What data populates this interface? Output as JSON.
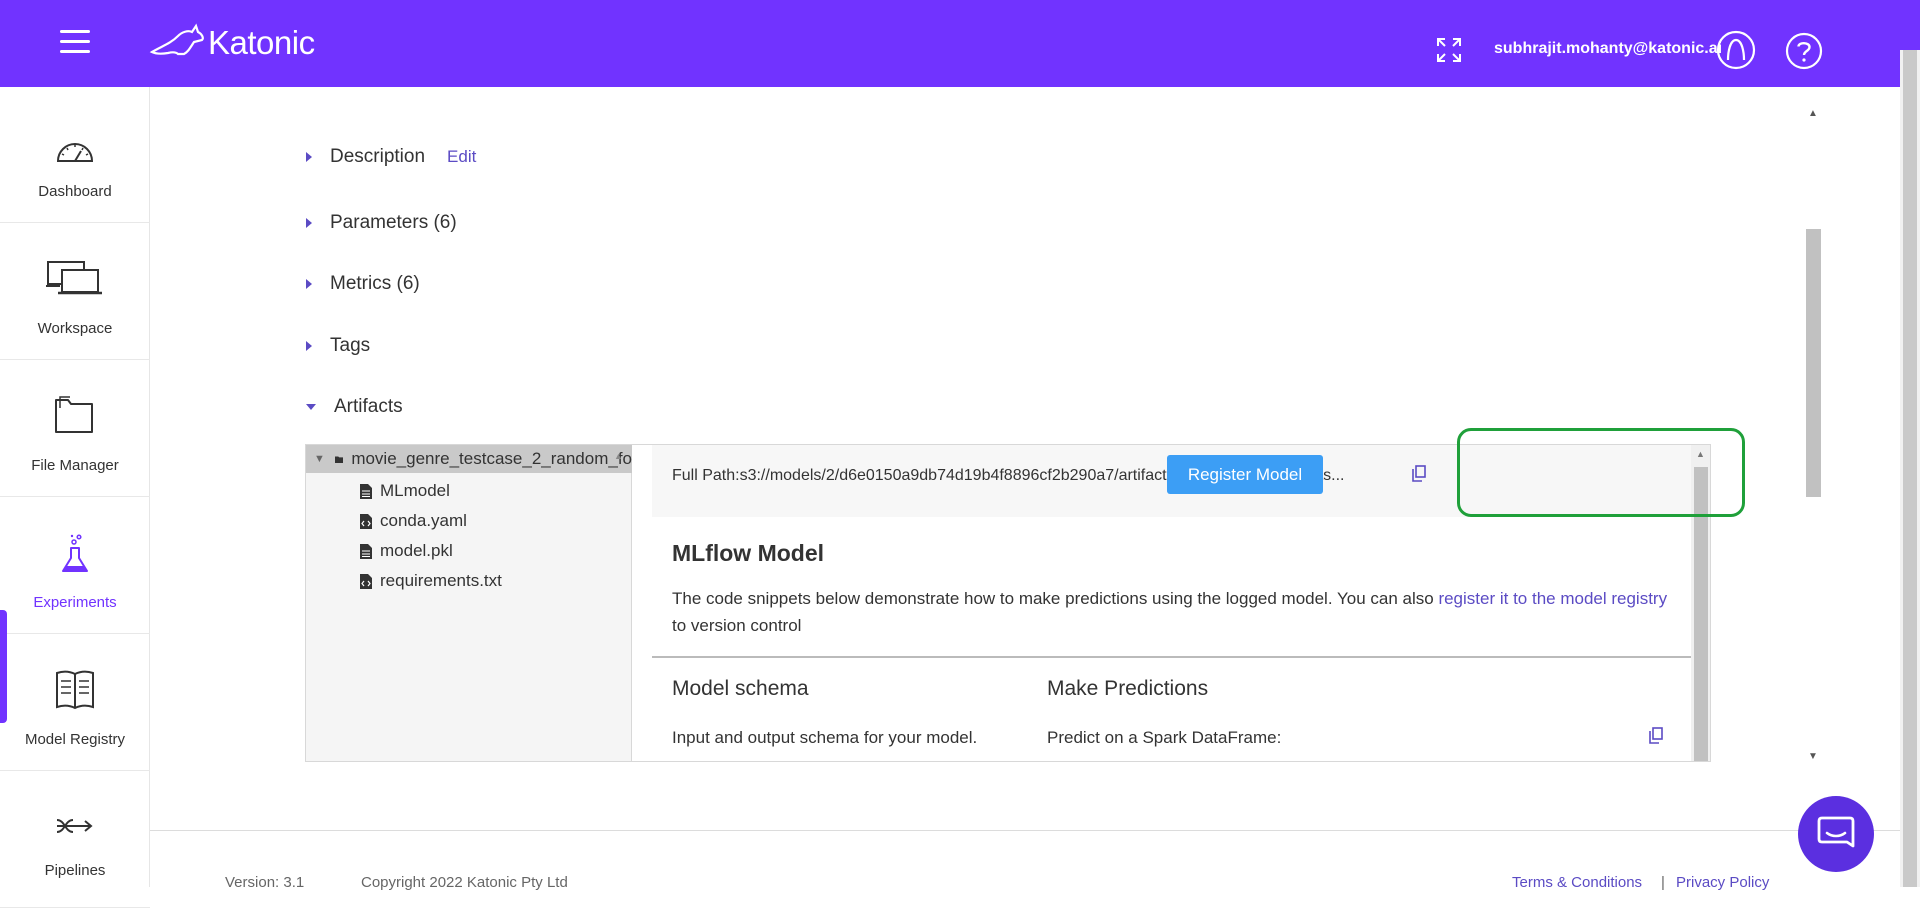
{
  "header": {
    "brand": "Katonic",
    "user_email": "subhrajit.mohanty@katonic.ai"
  },
  "sidebar": {
    "items": [
      {
        "label": "Dashboard",
        "icon": "gauge-icon"
      },
      {
        "label": "Workspace",
        "icon": "laptops-icon"
      },
      {
        "label": "File Manager",
        "icon": "folder-icon"
      },
      {
        "label": "Experiments",
        "icon": "flask-icon",
        "active": true
      },
      {
        "label": "Model Registry",
        "icon": "book-icon"
      },
      {
        "label": "Pipelines",
        "icon": "pipeline-icon"
      }
    ]
  },
  "sections": {
    "description": "Description",
    "edit": "Edit",
    "parameters": "Parameters (6)",
    "metrics": "Metrics (6)",
    "tags": "Tags",
    "artifacts": "Artifacts"
  },
  "artifacts": {
    "tree": {
      "root": "movie_genre_testcase_2_random_fo",
      "files": [
        "MLmodel",
        "conda.yaml",
        "model.pkl",
        "requirements.txt"
      ]
    },
    "full_path": "Full Path:s3://models/2/d6e0150a9db74d19b4f8896cf2b290a7/artifacts/movie_genre_testcas...",
    "register_button": "Register Model",
    "mlflow_title": "MLflow Model",
    "mlflow_desc_prefix": "The code snippets below demonstrate how to make predictions using the logged model. You can also ",
    "mlflow_desc_link": "register it to the model registry",
    "mlflow_desc_suffix": " to version control",
    "schema_title": "Model schema",
    "schema_desc": "Input and output schema for your model.",
    "predict_title": "Make Predictions",
    "predict_desc": "Predict on a Spark DataFrame:"
  },
  "footer": {
    "version": "Version: 3.1",
    "copyright": "Copyright 2022 Katonic Pty Ltd",
    "terms": "Terms & Conditions",
    "separator": "|",
    "privacy": "Privacy Policy"
  },
  "colors": {
    "brand": "#7133ff",
    "register_button": "#3c9ef5",
    "highlight": "#1fa03a",
    "link": "#5b4bc4"
  }
}
